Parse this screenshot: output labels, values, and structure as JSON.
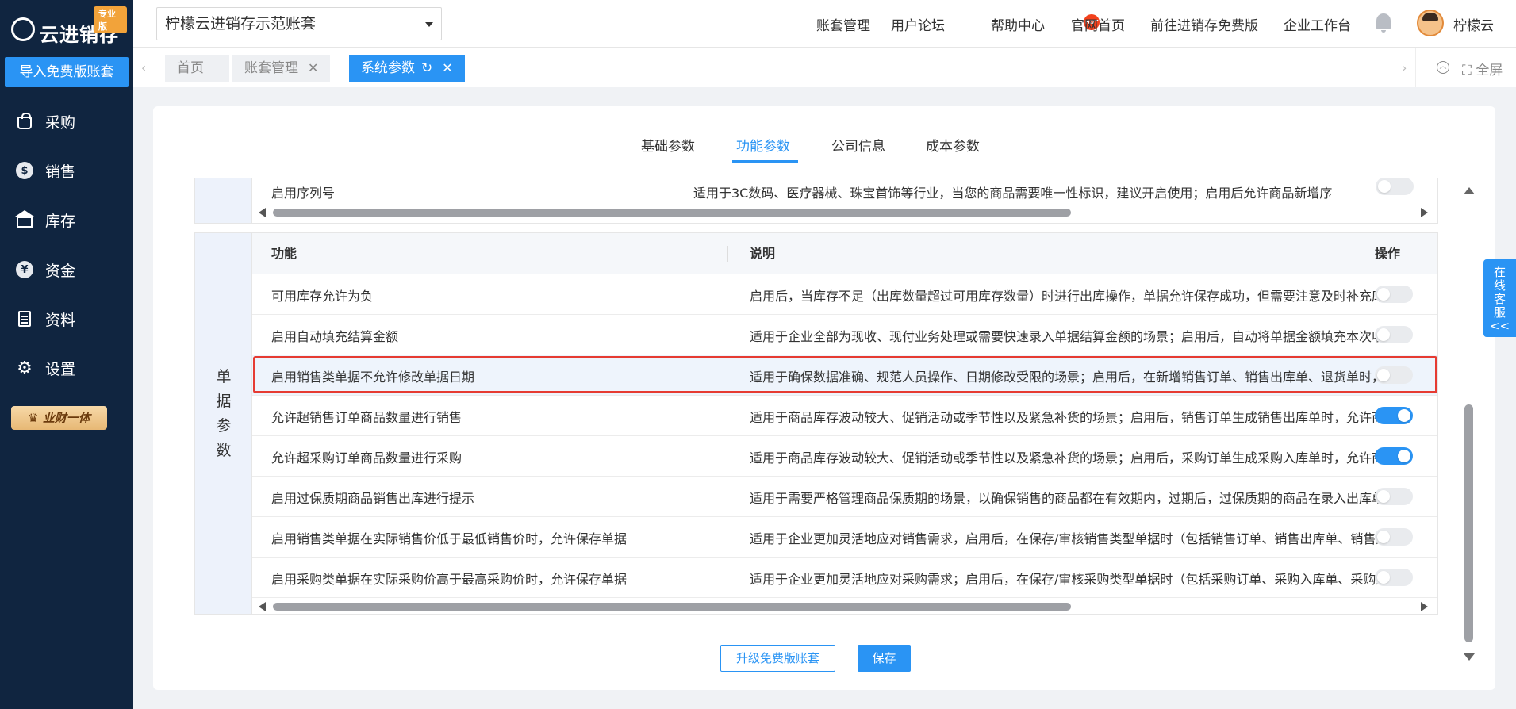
{
  "app": {
    "logo_text": "云进销存",
    "edition_badge": "专业版",
    "import_button": "导入免费版账套",
    "vip_button": "业财一体"
  },
  "sidebar": {
    "items": [
      {
        "label": "采购",
        "icon": "shopping-bag-icon"
      },
      {
        "label": "销售",
        "icon": "sales-tag-icon"
      },
      {
        "label": "库存",
        "icon": "warehouse-icon"
      },
      {
        "label": "资金",
        "icon": "yen-coin-icon"
      },
      {
        "label": "资料",
        "icon": "document-icon"
      },
      {
        "label": "设置",
        "icon": "gear-icon"
      }
    ]
  },
  "header": {
    "account_select": "柠檬云进销存示范账套",
    "links": [
      "账套管理",
      "用户论坛",
      "帮助中心",
      "官网首页",
      "前往进销存免费版",
      "企业工作台"
    ],
    "hot_badge": "HOT",
    "username": "柠檬云"
  },
  "tabbar": {
    "tabs": [
      {
        "label": "首页",
        "closable": false
      },
      {
        "label": "账套管理",
        "closable": true
      },
      {
        "label": "系统参数",
        "closable": true
      }
    ],
    "fullscreen": "全屏"
  },
  "param_tabs": [
    "基础参数",
    "功能参数",
    "公司信息",
    "成本参数"
  ],
  "active_param_tab": "功能参数",
  "top_table": {
    "row": {
      "feature": "启用序列号",
      "description": "适用于3C数码、医疗器械、珠宝首饰等行业，当您的商品需要唯一性标识，建议开启使用；启用后允许商品新增序",
      "enabled": false
    }
  },
  "main_table": {
    "category_label": [
      "单",
      "据",
      "参",
      "数"
    ],
    "headers": {
      "feature": "功能",
      "description": "说明",
      "action": "操作"
    },
    "rows": [
      {
        "feature": "可用库存允许为负",
        "description": "启用后，当库存不足（出库数量超过可用库存数量）时进行出库操作，单据允许保存成功，但需要注意及时补充库",
        "enabled": false
      },
      {
        "feature": "启用自动填充结算金额",
        "description": "适用于企业全部为现收、现付业务处理或需要快速录入单据结算金额的场景；启用后，自动将单据金额填充本次收",
        "enabled": false
      },
      {
        "feature": "启用销售类单据不允许修改单据日期",
        "description": "适用于确保数据准确、规范人员操作、日期修改受限的场景；启用后，在新增销售订单、销售出库单、退货单时，",
        "enabled": false
      },
      {
        "feature": "允许超销售订单商品数量进行销售",
        "description": "适用于商品库存波动较大、促销活动或季节性以及紧急补货的场景；启用后，销售订单生成销售出库单时，允许商",
        "enabled": true
      },
      {
        "feature": "允许超采购订单商品数量进行采购",
        "description": "适用于商品库存波动较大、促销活动或季节性以及紧急补货的场景；启用后，采购订单生成采购入库单时，允许商",
        "enabled": true
      },
      {
        "feature": "启用过保质期商品销售出库进行提示",
        "description": "适用于需要严格管理商品保质期的场景，以确保销售的商品都在有效期内，过期后，过保质期的商品在录入出库单",
        "enabled": false
      },
      {
        "feature": "启用销售类单据在实际销售价低于最低销售价时，允许保存单据",
        "description": "适用于企业更加灵活地应对销售需求，启用后，在保存/审核销售类型单据时（包括销售订单、销售出库单、销售退",
        "enabled": false
      },
      {
        "feature": "启用采购类单据在实际采购价高于最高采购价时，允许保存单据",
        "description": "适用于企业更加灵活地应对采购需求；启用后，在保存/审核采购类型单据时（包括采购订单、采购入库单、采购退",
        "enabled": false
      }
    ]
  },
  "footer": {
    "upgrade_button": "升级免费版账套",
    "save_button": "保存"
  },
  "customer_service": {
    "lines": [
      "在",
      "线",
      "客",
      "服",
      "<<"
    ]
  },
  "colors": {
    "sidebar_bg": "#102540",
    "primary": "#2a94f4",
    "highlight_border": "#e63b32"
  }
}
